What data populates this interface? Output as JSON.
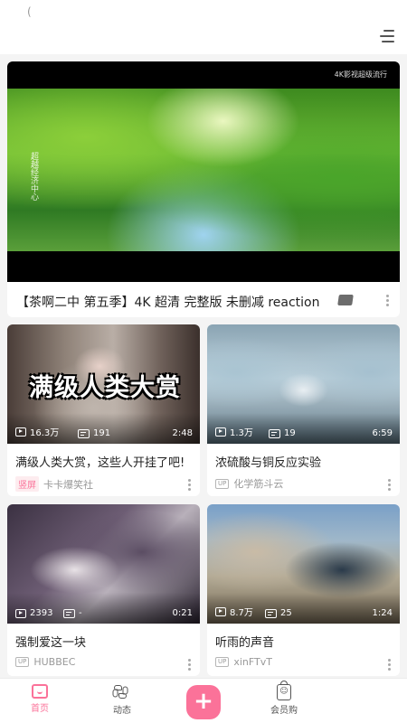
{
  "status": {
    "glyph": "("
  },
  "feature": {
    "badge": "4K影视超级流行",
    "caption": "超越经济中心",
    "title": "【茶啊二中 第五季】4K 超清 完整版 未删减 reaction"
  },
  "cards": [
    {
      "overlay_text": "满级人类大赏",
      "views": "16.3万",
      "danmaku": "191",
      "duration": "2:48",
      "title": "满级人类大赏，这些人开挂了吧!",
      "tag": "竖屏",
      "author": "卡卡爆笑社"
    },
    {
      "views": "1.3万",
      "danmaku": "19",
      "duration": "6:59",
      "title": "浓硫酸与铜反应实验",
      "up_label": "UP",
      "author": "化学筋斗云"
    },
    {
      "views": "2393",
      "danmaku": "-",
      "duration": "0:21",
      "title": "强制爱这一块",
      "up_label": "UP",
      "author": "HUBBEC"
    },
    {
      "views": "8.7万",
      "danmaku": "25",
      "duration": "1:24",
      "title": "听雨的声音",
      "up_label": "UP",
      "author": "xinFTvT"
    }
  ],
  "nav": {
    "home": "首页",
    "dynamic": "动态",
    "add": "+",
    "shop": "会员购",
    "shop_glyph": "☺"
  },
  "colors": {
    "accent": "#fb7299",
    "background": "#f4f4f4"
  }
}
